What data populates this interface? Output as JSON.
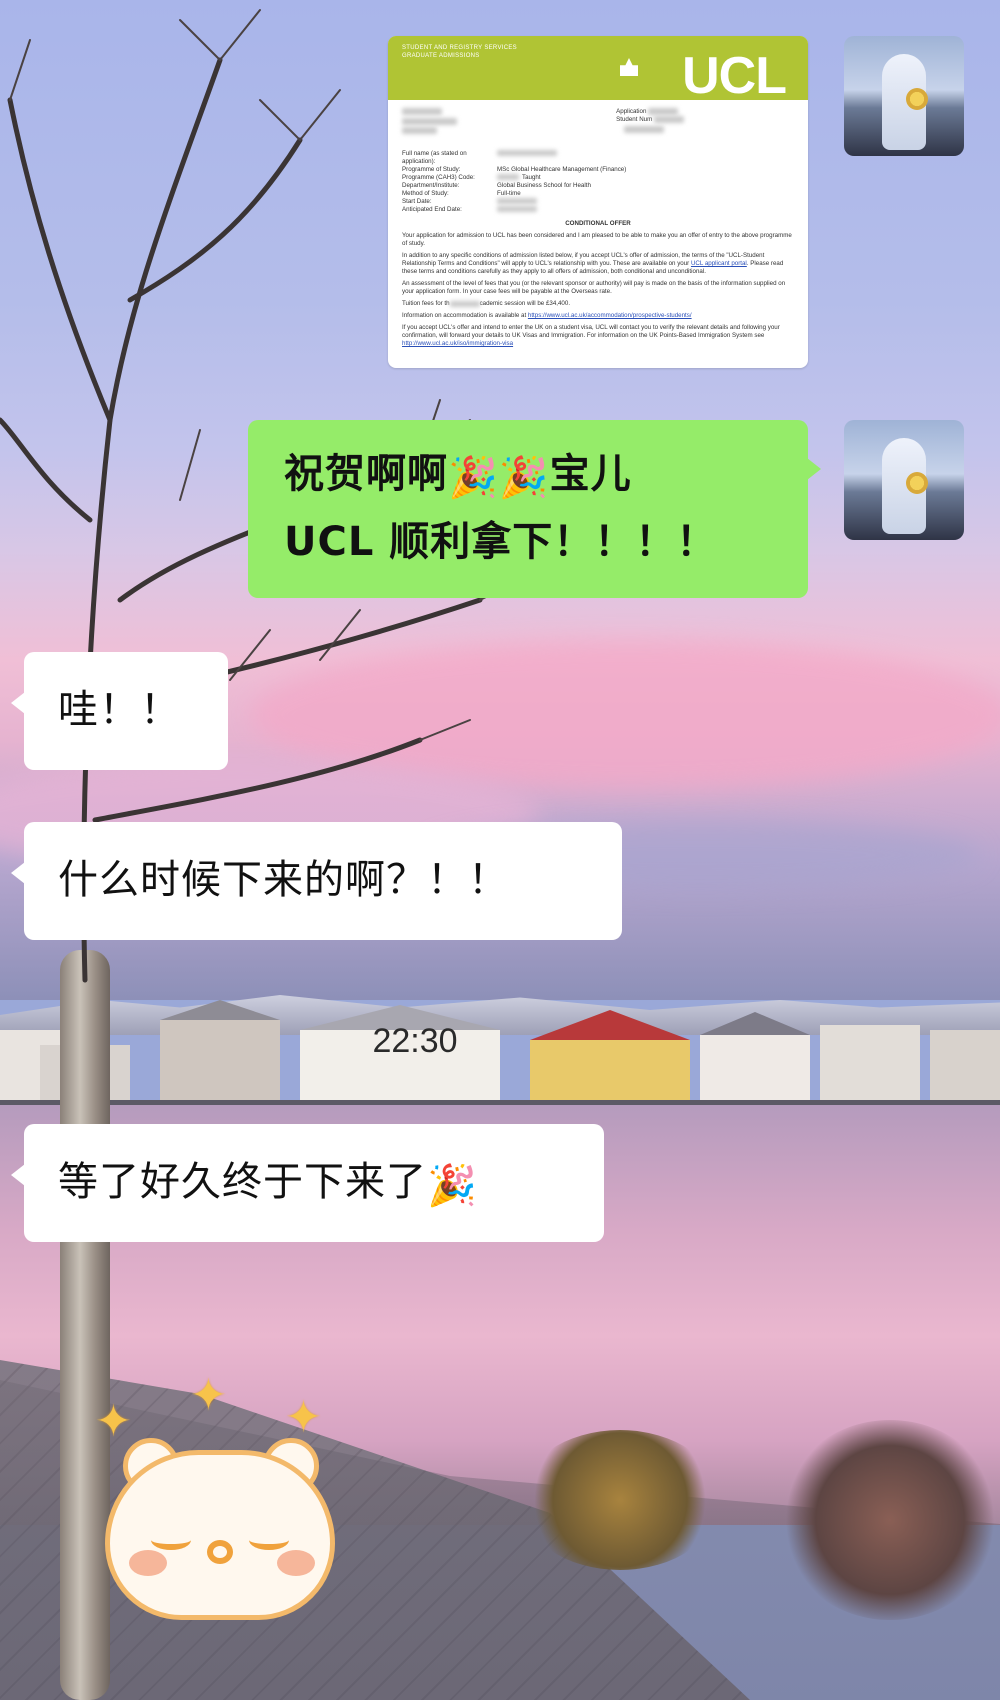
{
  "conversation": {
    "messages": [
      {
        "sender": "self",
        "type": "image",
        "image_description": "UCL conditional offer letter"
      },
      {
        "sender": "self",
        "type": "text",
        "line1_prefix": "祝贺啊啊",
        "line1_suffix": "宝儿",
        "line2": "UCL 顺利拿下！！！！",
        "emoji": "party-popper"
      },
      {
        "sender": "other",
        "type": "text",
        "text": "哇！！"
      },
      {
        "sender": "other",
        "type": "text",
        "text": "什么时候下来的啊？！！"
      },
      {
        "sender": "other",
        "type": "text",
        "text": "等了好久终于下来了",
        "emoji": "party-popper"
      },
      {
        "sender": "other",
        "type": "sticker",
        "sticker": "sparkle-bear-sticker"
      }
    ],
    "timestamp": "22:30"
  },
  "offer_letter": {
    "department_line1": "STUDENT AND REGISTRY SERVICES",
    "department_line2": "GRADUATE ADMISSIONS",
    "logo_text": "UCL",
    "header_color": "#b0c434",
    "application_label": "Application",
    "student_number_label": "Student Num",
    "fields": [
      {
        "label": "Full name (as stated on application):",
        "value": ""
      },
      {
        "label": "Programme of Study:",
        "value": "MSc Global Healthcare Management (Finance)"
      },
      {
        "label": "Programme (CAH3) Code:",
        "value": "Taught"
      },
      {
        "label": "Department/Institute:",
        "value": "Global Business School for Health"
      },
      {
        "label": "Method of Study:",
        "value": "Full-time"
      },
      {
        "label": "Start Date:",
        "value": ""
      },
      {
        "label": "Anticipated End Date:",
        "value": ""
      }
    ],
    "title": "CONDITIONAL OFFER",
    "paragraph1": "Your application for admission to UCL has been considered and I am pleased to be able to make you an offer of entry to the above programme of study.",
    "paragraph2_a": "In addition to any specific conditions of admission listed below, if you accept UCL's offer of admission, the terms of the \"UCL-Student Relationship Terms and Conditions\" will apply to UCL's relationship with you. These are available on your ",
    "paragraph2_link": "UCL applicant portal",
    "paragraph2_b": ". Please read these terms and conditions carefully as they apply to all offers of admission, both conditional and unconditional.",
    "paragraph3": "An assessment of the level of fees that you (or the relevant sponsor or authority) will pay is made on the basis of the information supplied on your application form. In your case fees will be payable at the Overseas rate.",
    "tuition_prefix": "Tuition fees for th",
    "tuition_suffix": "cademic session will be £34,400.",
    "accommodation_prefix": "Information on accommodation is available at ",
    "accommodation_link": "https://www.ucl.ac.uk/accommodation/prospective-students/",
    "visa_text": "If you accept UCL's offer and intend to enter the UK on a student visa, UCL will contact you to verify the relevant details and following your confirmation, will forward your details to UK Visas and Immigration. For information on the UK Points-Based Immigration System see",
    "visa_link": "http://www.ucl.ac.uk/iso/immigration-visa"
  },
  "colors": {
    "outgoing_bubble": "#95ec69",
    "incoming_bubble": "#ffffff"
  }
}
